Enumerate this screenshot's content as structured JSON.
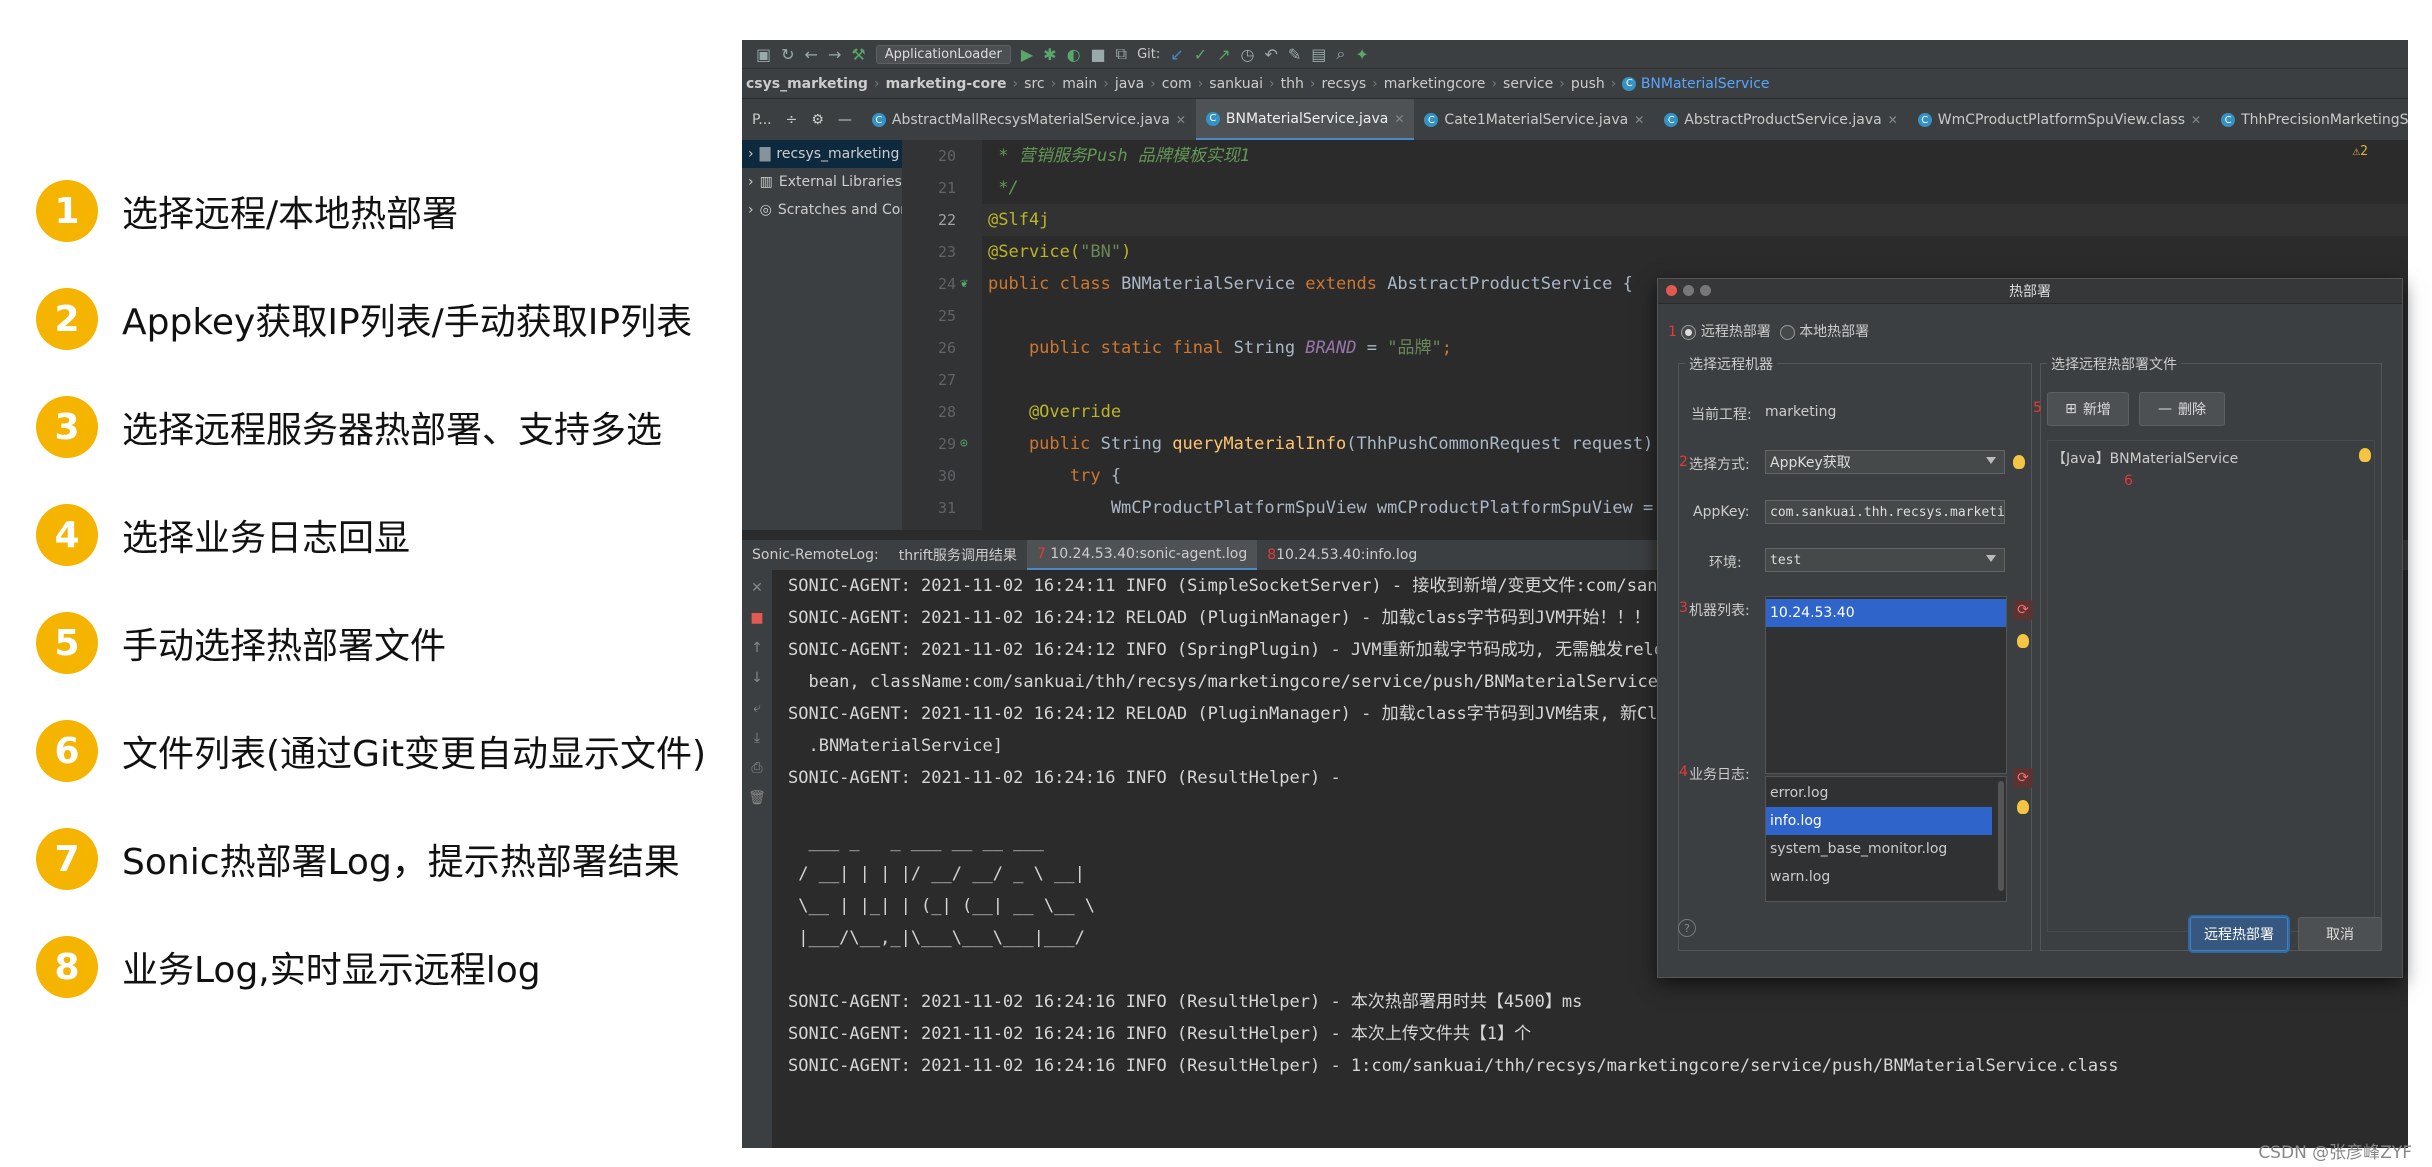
{
  "legend": [
    {
      "num": "1",
      "text": "选择远程/本地热部署"
    },
    {
      "num": "2",
      "text": "Appkey获取IP列表/手动获取IP列表"
    },
    {
      "num": "3",
      "text": "选择远程服务器热部署、支持多选"
    },
    {
      "num": "4",
      "text": "选择业务日志回显"
    },
    {
      "num": "5",
      "text": "手动选择热部署文件"
    },
    {
      "num": "6",
      "text": "文件列表(通过Git变更自动显示文件)"
    },
    {
      "num": "7",
      "text": "Sonic热部署Log，提示热部署结果"
    },
    {
      "num": "8",
      "text": "业务Log,实时显示远程log"
    }
  ],
  "toolbar": {
    "run_config": "ApplicationLoader",
    "git_label": "Git:"
  },
  "breadcrumb": [
    "csys_marketing",
    "marketing-core",
    "src",
    "main",
    "java",
    "com",
    "sankuai",
    "thh",
    "recsys",
    "marketingcore",
    "service",
    "push",
    "BNMaterialService"
  ],
  "project_label": "P...",
  "tabs": [
    {
      "label": "AbstractMallRecsysMaterialService.java",
      "active": false
    },
    {
      "label": "BNMaterialService.java",
      "active": true
    },
    {
      "label": "Cate1MaterialService.java",
      "active": false
    },
    {
      "label": "AbstractProductService.java",
      "active": false
    },
    {
      "label": "WmCProductPlatformSpuView.class",
      "active": false
    },
    {
      "label": "ThhPrecisionMarketingSpuInfo.java",
      "active": false
    }
  ],
  "project_tree": [
    "recsys_marketing [",
    "External Libraries",
    "Scratches and Con"
  ],
  "line_numbers": [
    "20",
    "21",
    "22",
    "23",
    "24",
    "25",
    "26",
    "27",
    "28",
    "29",
    "30",
    "31"
  ],
  "code": {
    "l20": " * 营销服务Push 品牌模板实现1",
    "l21": " */",
    "l22": "@Slf4j",
    "l23a": "@Service(",
    "l23b": "\"BN\"",
    "l23c": ")",
    "l24a": "public class ",
    "l24b": "BNMaterialService ",
    "l24c": "extends ",
    "l24d": "AbstractProductService {",
    "l26a": "    public static final ",
    "l26b": "String ",
    "l26c": "BRAND",
    "l26d": " = ",
    "l26e": "\"品牌\"",
    "l26f": ";",
    "l28": "    @Override",
    "l29a": "    public ",
    "l29b": "String ",
    "l29c": "queryMaterialInfo",
    "l29d": "(ThhPushCommonRequest request) {",
    "l30a": "        try ",
    "l30b": "{",
    "l31": "            WmCProductPlatformSpuView wmCProductPlatformSpuView = queryProdu"
  },
  "warn_count": "⚠2",
  "log_tabs": {
    "label": "Sonic-RemoteLog:",
    "t1": "thrift服务调用结果",
    "n7": "7",
    "t2": "10.24.53.40:sonic-agent.log",
    "n8": "8",
    "t3": "10.24.53.40:info.log"
  },
  "log_lines": [
    "SONIC-AGENT: 2021-11-02 16:24:11 INFO (SimpleSocketServer) - 接收到新增/变更文件:com/sankuai/thh/r",
    "SONIC-AGENT: 2021-11-02 16:24:12 RELOAD (PluginManager) - 加载class字节码到JVM开始！！！ classes [",
    "SONIC-AGENT: 2021-11-02 16:24:12 INFO (SpringPlugin) - JVM重新加载字节码成功, 无需触发reload spring",
    "  bean, className:com/sankuai/thh/recsys/marketingcore/service/push/BNMaterialService",
    "SONIC-AGENT: 2021-11-02 16:24:12 RELOAD (PluginManager) - 加载class字节码到JVM结束, 新Class字节码已",
    "  .BNMaterialService]",
    "SONIC-AGENT: 2021-11-02 16:24:16 INFO (ResultHelper) -",
    "",
    "  ___ _   _ ___ __ __ ___",
    " / __| | | |/ __/ __/ _ \\ __|",
    " \\__ | |_| | (_| (__| __ \\__ \\",
    " |___/\\__,_|\\___\\___\\___|___/",
    "",
    "SONIC-AGENT: 2021-11-02 16:24:16 INFO (ResultHelper) - 本次热部署用时共【4500】ms",
    "SONIC-AGENT: 2021-11-02 16:24:16 INFO (ResultHelper) - 本次上传文件共【1】个",
    "SONIC-AGENT: 2021-11-02 16:24:16 INFO (ResultHelper) - 1:com/sankuai/thh/recsys/marketingcore/service/push/BNMaterialService.class"
  ],
  "dialog": {
    "title": "热部署",
    "mark1": "1",
    "radio_remote": "远程热部署",
    "radio_local": "本地热部署",
    "left_panel_title": "选择远程机器",
    "right_panel_title": "选择远程热部署文件",
    "project_label": "当前工程:",
    "project_value": "marketing",
    "mark2": "2",
    "method_label": "选择方式:",
    "method_value": "AppKey获取",
    "appkey_label": "AppKey:",
    "appkey_value": "com.sankuai.thh.recsys.marketing",
    "env_label": "环境:",
    "env_value": "test",
    "mark3": "3",
    "machine_label": "机器列表:",
    "machines": [
      "10.24.53.40"
    ],
    "mark4": "4",
    "biz_log_label": "业务日志:",
    "logs": [
      "error.log",
      "info.log",
      "system_base_monitor.log",
      "warn.log"
    ],
    "mark5": "5",
    "add_label": "新增",
    "delete_label": "删除",
    "file_item": "【Java】BNMaterialService",
    "mark6": "6",
    "deploy_button": "远程热部署",
    "cancel_button": "取消"
  },
  "watermark": "CSDN @张彦峰ZYF"
}
